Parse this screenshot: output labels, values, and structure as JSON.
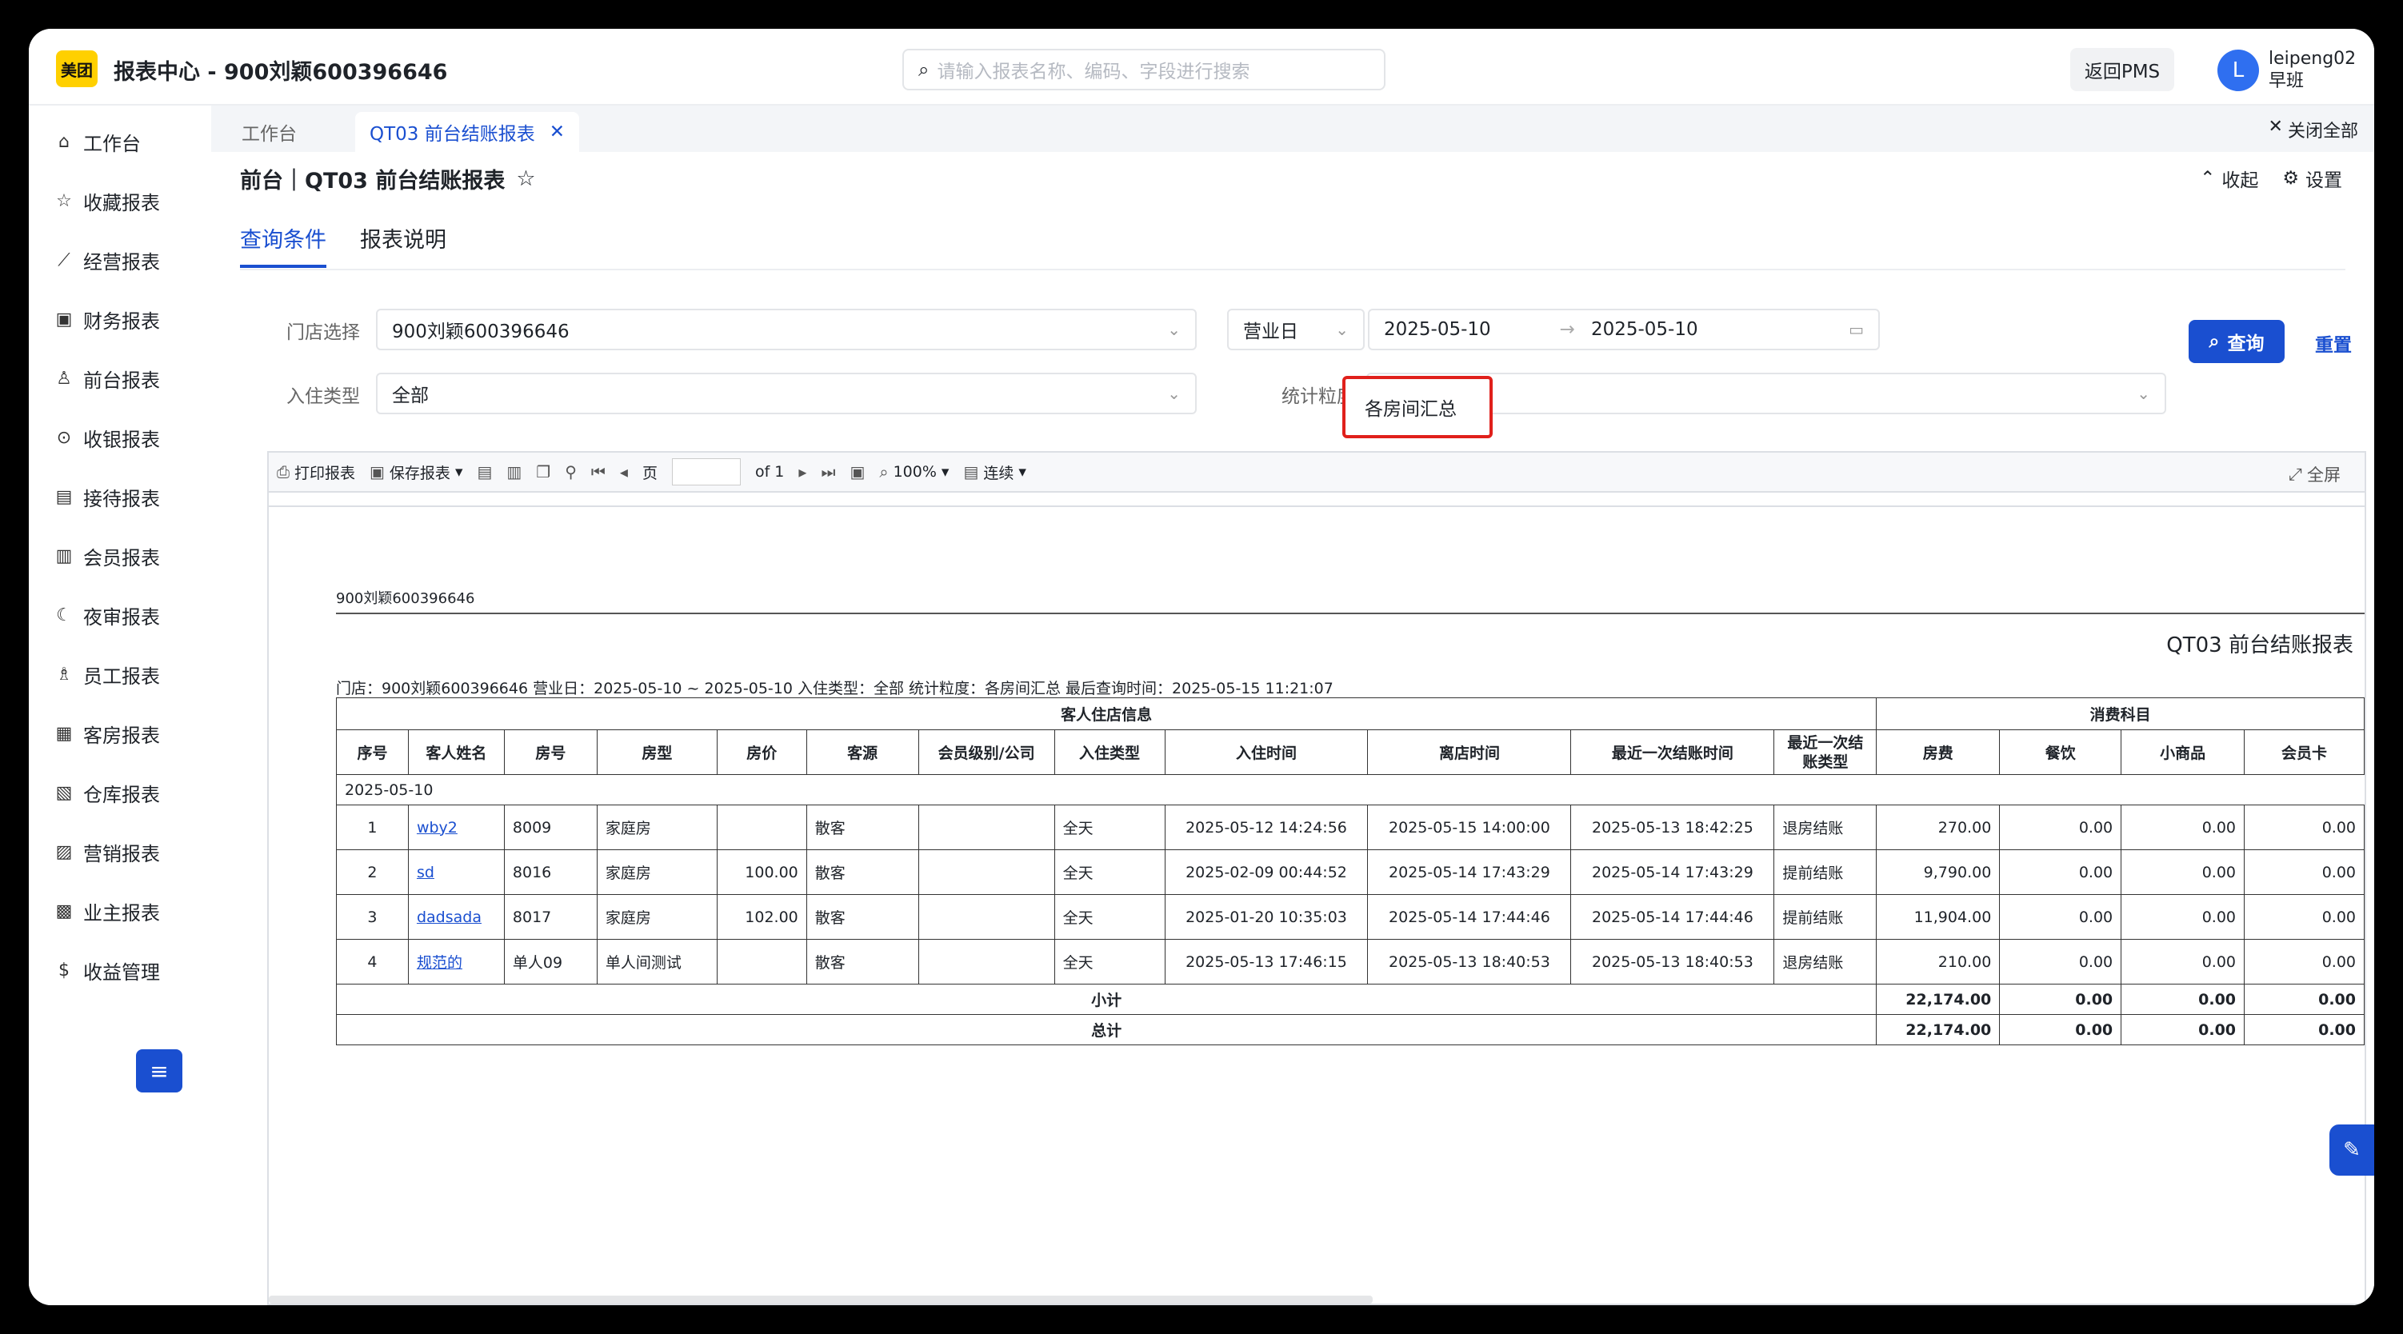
{
  "app": {
    "logo_text": "美团",
    "title": "报表中心 - 900刘颖600396646",
    "search_placeholder": "请输入报表名称、编码、字段进行搜索",
    "return_pms": "返回PMS",
    "avatar_letter": "L",
    "user_name": "leipeng02",
    "user_shift": "早班"
  },
  "sidebar": {
    "items": [
      {
        "label": "工作台",
        "icon": "home-icon",
        "glyph": "⌂"
      },
      {
        "label": "收藏报表",
        "icon": "star-icon",
        "glyph": "☆"
      },
      {
        "label": "经营报表",
        "icon": "line-chart-icon",
        "glyph": "⟋"
      },
      {
        "label": "财务报表",
        "icon": "ledger-icon",
        "glyph": "▣"
      },
      {
        "label": "前台报表",
        "icon": "person-icon",
        "glyph": "♙"
      },
      {
        "label": "收银报表",
        "icon": "coin-icon",
        "glyph": "⊙"
      },
      {
        "label": "接待报表",
        "icon": "reception-icon",
        "glyph": "▤"
      },
      {
        "label": "会员报表",
        "icon": "member-card-icon",
        "glyph": "▥"
      },
      {
        "label": "夜审报表",
        "icon": "moon-icon",
        "glyph": "☾"
      },
      {
        "label": "员工报表",
        "icon": "staff-icon",
        "glyph": "♗"
      },
      {
        "label": "客房报表",
        "icon": "room-icon",
        "glyph": "▦"
      },
      {
        "label": "仓库报表",
        "icon": "warehouse-icon",
        "glyph": "▧"
      },
      {
        "label": "营销报表",
        "icon": "gift-icon",
        "glyph": "▨"
      },
      {
        "label": "业主报表",
        "icon": "owner-icon",
        "glyph": "▩"
      },
      {
        "label": "收益管理",
        "icon": "dollar-icon",
        "glyph": "$"
      }
    ],
    "toggle_glyph": "≡"
  },
  "tabs": {
    "home": "工作台",
    "active": "QT03 前台结账报表",
    "close_all": "关闭全部"
  },
  "page": {
    "title": "前台｜QT03 前台结账报表",
    "collapse": "收起",
    "settings": "设置",
    "subtab_query": "查询条件",
    "subtab_desc": "报表说明"
  },
  "form": {
    "store_label": "门店选择",
    "store_value": "900刘颖600396646",
    "checkin_type_label": "入住类型",
    "checkin_type_value": "全部",
    "date_type_value": "营业日",
    "date_start": "2025-05-10",
    "date_end": "2025-05-10",
    "granularity_label": "统计粒度",
    "granularity_value": "各房间汇总",
    "query_button": "查询",
    "reset_button": "重置"
  },
  "viewer_toolbar": {
    "print": "打印报表",
    "save": "保存报表",
    "page_label": "页",
    "page_of": "of 1",
    "zoom": "100%",
    "mode": "连续",
    "fullscreen": "全屏"
  },
  "report": {
    "store_header": "900刘颖600396646",
    "title": "QT03 前台结账报表",
    "info": "门店：900刘颖600396646    营业日：2025-05-10 ~ 2025-05-10    入住类型：全部    统计粒度：各房间汇总    最后查询时间：2025-05-15 11:21:07",
    "group_guest": "客人住店信息",
    "group_consume": "消费科目",
    "columns": [
      "序号",
      "客人姓名",
      "房号",
      "房型",
      "房价",
      "客源",
      "会员级别/公司",
      "入住类型",
      "入住时间",
      "离店时间",
      "最近一次结账时间",
      "最近一次结账类型",
      "房费",
      "餐饮",
      "小商品",
      "会员卡"
    ],
    "date_group": "2025-05-10",
    "rows": [
      [
        "1",
        "wby2",
        "8009",
        "家庭房",
        "",
        "散客",
        "",
        "全天",
        "2025-05-12 14:24:56",
        "2025-05-15 14:00:00",
        "2025-05-13 18:42:25",
        "退房结账",
        "270.00",
        "0.00",
        "0.00",
        "0.00"
      ],
      [
        "2",
        "sd",
        "8016",
        "家庭房",
        "100.00",
        "散客",
        "",
        "全天",
        "2025-02-09 00:44:52",
        "2025-05-14 17:43:29",
        "2025-05-14 17:43:29",
        "提前结账",
        "9,790.00",
        "0.00",
        "0.00",
        "0.00"
      ],
      [
        "3",
        "dadsada",
        "8017",
        "家庭房",
        "102.00",
        "散客",
        "",
        "全天",
        "2025-01-20 10:35:03",
        "2025-05-14 17:44:46",
        "2025-05-14 17:44:46",
        "提前结账",
        "11,904.00",
        "0.00",
        "0.00",
        "0.00"
      ],
      [
        "4",
        "规范的",
        "单人09",
        "单人间测试",
        "",
        "散客",
        "",
        "全天",
        "2025-05-13 17:46:15",
        "2025-05-13 18:40:53",
        "2025-05-13 18:40:53",
        "退房结账",
        "210.00",
        "0.00",
        "0.00",
        "0.00"
      ]
    ],
    "subtotal_label": "小计",
    "subtotal": [
      "22,174.00",
      "0.00",
      "0.00",
      "0.00"
    ],
    "total_label": "总计",
    "total": [
      "22,174.00",
      "0.00",
      "0.00",
      "0.00"
    ]
  }
}
